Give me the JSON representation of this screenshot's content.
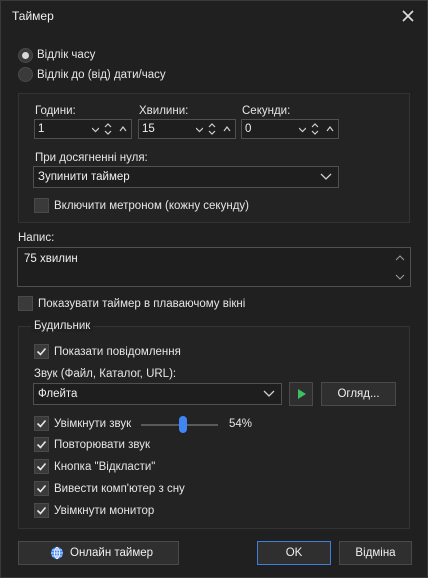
{
  "window": {
    "title": "Таймер"
  },
  "mode": {
    "option_countdown": "Відлік часу",
    "option_date": "Відлік до (від) дати/часу",
    "selected": "countdown"
  },
  "time": {
    "hours_label": "Години:",
    "hours_value": "1",
    "minutes_label": "Хвилини:",
    "minutes_value": "15",
    "seconds_label": "Секунди:",
    "seconds_value": "0"
  },
  "on_zero": {
    "label": "При досягненні нуля:",
    "value": "Зупинити таймер"
  },
  "metronome": {
    "label": "Включити метроном (кожну секунду)",
    "checked": false
  },
  "caption": {
    "label": "Напис:",
    "value": "75 хвилин"
  },
  "floating": {
    "label": "Показувати таймер в плаваючому вікні",
    "checked": false
  },
  "alarm": {
    "group_label": "Будильник",
    "show_message": {
      "label": "Показати повідомлення",
      "checked": true
    },
    "sound_label": "Звук (Файл, Каталог, URL):",
    "sound_value": "Флейта",
    "browse_label": "Огляд...",
    "enable_sound": {
      "label": "Увімкнути звук",
      "checked": true
    },
    "volume_text": "54%",
    "volume_fraction": 0.54,
    "repeat_sound": {
      "label": "Повторювати звук",
      "checked": true
    },
    "snooze_button": {
      "label": "Кнопка \"Відкласти\"",
      "checked": true
    },
    "wake_computer": {
      "label": "Вивести комп'ютер з сну",
      "checked": true
    },
    "turn_on_monitor": {
      "label": "Увімкнути монитор",
      "checked": true
    }
  },
  "footer": {
    "online_label": "Онлайн таймер",
    "ok_label": "OK",
    "cancel_label": "Відміна"
  },
  "colors": {
    "accent": "#3f86f4",
    "play": "#3cc060",
    "background": "#202020"
  }
}
